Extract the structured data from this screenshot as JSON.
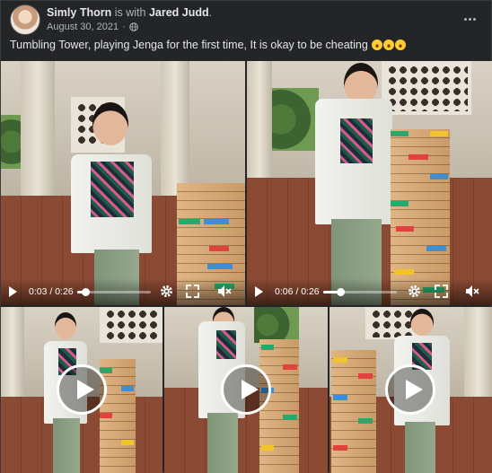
{
  "post": {
    "author": "Simly Thorn",
    "connector": "is with",
    "tagged": "Jared Judd",
    "period": ".",
    "date": "August 30, 2021",
    "separator": "·",
    "privacy_icon": "globe-icon",
    "more_icon": "more-options-icon",
    "caption": "Tumbling Tower, playing Jenga for the first time, It is okay to be cheating",
    "caption_emoji": [
      "rolling-on-floor-laughing-emoji",
      "rolling-on-floor-laughing-emoji",
      "rolling-on-floor-laughing-emoji"
    ]
  },
  "videos": [
    {
      "time": "0:03 / 0:26",
      "progress": 0.115,
      "icons": [
        "play-icon",
        "settings-gear-icon",
        "fullscreen-icon",
        "mute-icon"
      ]
    },
    {
      "time": "0:06 / 0:26",
      "progress": 0.23,
      "icons": [
        "play-icon",
        "settings-gear-icon",
        "fullscreen-icon",
        "mute-icon"
      ]
    }
  ],
  "thumbnails": [
    {
      "icon": "play-circle-icon"
    },
    {
      "icon": "play-circle-icon"
    },
    {
      "icon": "play-circle-icon"
    }
  ],
  "colors": {
    "background": "#242526",
    "text_primary": "#e4e6eb",
    "text_secondary": "#b0b3b8",
    "block_green": "#2aa86b",
    "block_blue": "#3b8fd6",
    "block_red": "#e0423d",
    "block_yellow": "#f2c42a"
  }
}
